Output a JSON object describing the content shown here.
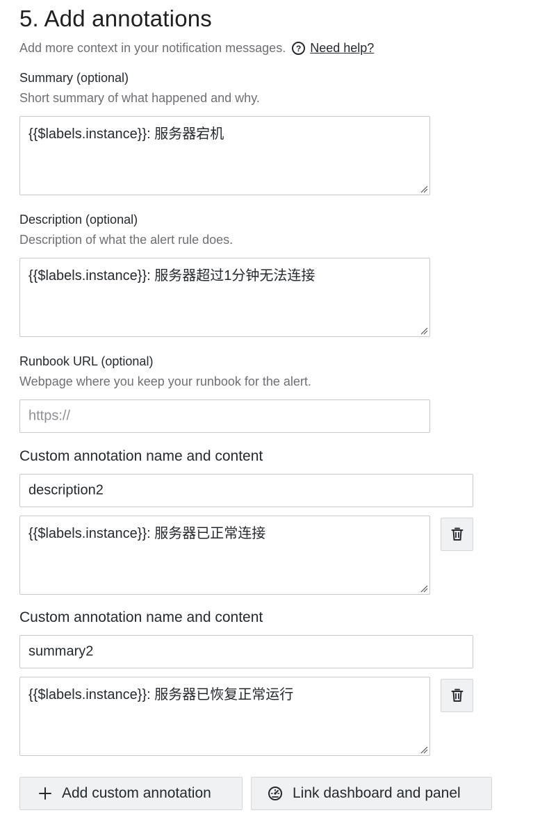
{
  "section": {
    "title": "5. Add annotations",
    "subtitle": "Add more context in your notification messages.",
    "help_link": "Need help?",
    "help_icon": "question-circle-icon"
  },
  "summary": {
    "label": "Summary (optional)",
    "description": "Short summary of what happened and why.",
    "value": "{{$labels.instance}}: 服务器宕机"
  },
  "description_field": {
    "label": "Description (optional)",
    "description": "Description of what the alert rule does.",
    "value": "{{$labels.instance}}: 服务器超过1分钟无法连接"
  },
  "runbook": {
    "label": "Runbook URL (optional)",
    "description": "Webpage where you keep your runbook for the alert.",
    "value": "",
    "placeholder": "https://"
  },
  "custom_annotations": [
    {
      "label": "Custom annotation name and content",
      "name_value": "description2",
      "content_value": "{{$labels.instance}}: 服务器已正常连接",
      "delete_icon": "trash-icon"
    },
    {
      "label": "Custom annotation name and content",
      "name_value": "summary2",
      "content_value": "{{$labels.instance}}: 服务器已恢复正常运行",
      "delete_icon": "trash-icon"
    }
  ],
  "actions": {
    "add_custom_label": "Add custom annotation",
    "add_custom_icon": "plus-icon",
    "link_dashboard_label": "Link dashboard and panel",
    "link_dashboard_icon": "dashboard-gauge-icon"
  }
}
